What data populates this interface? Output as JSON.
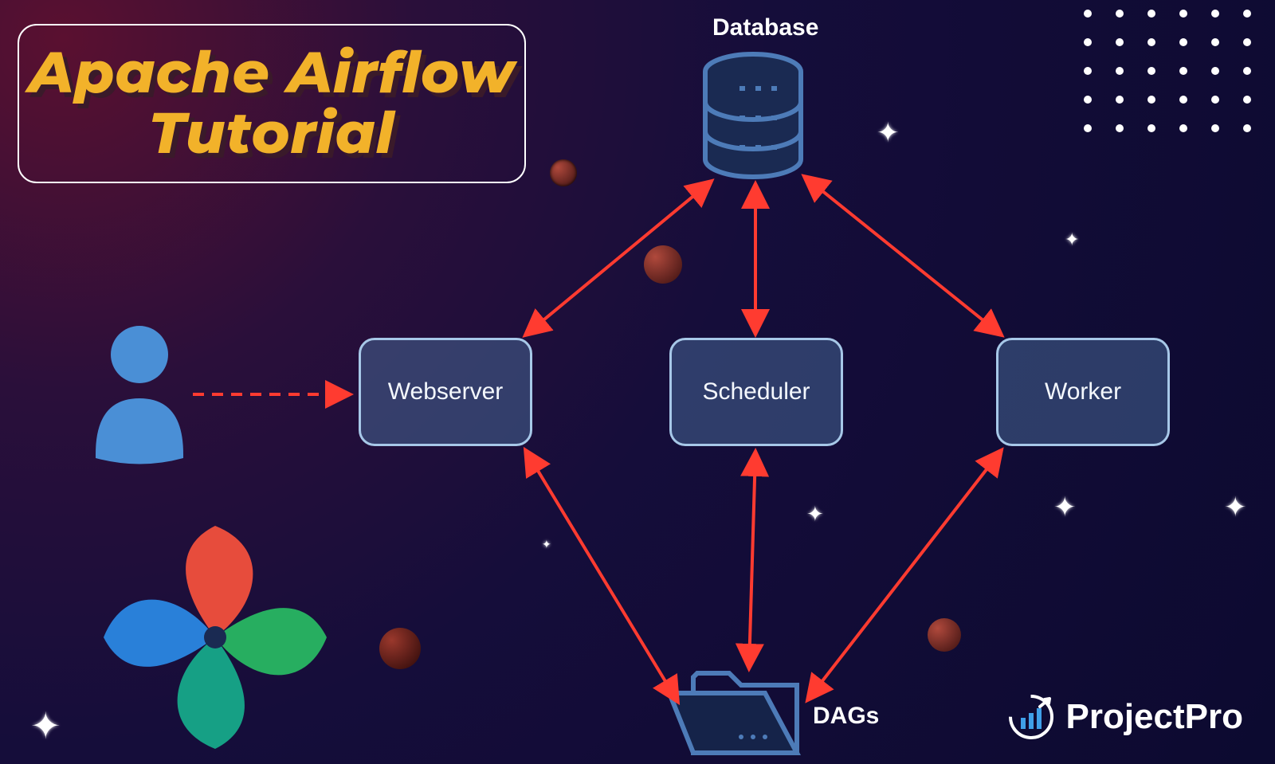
{
  "title": {
    "line1": "Apache Airflow",
    "line2": "Tutorial"
  },
  "nodes": {
    "database": "Database",
    "webserver": "Webserver",
    "scheduler": "Scheduler",
    "worker": "Worker",
    "dags": "DAGs"
  },
  "brand": "ProjectPro",
  "colors": {
    "accent": "#f2b22a",
    "arrow": "#ff3b30",
    "box_border": "#a7c8e8",
    "box_fill": "rgba(74,110,155,0.5)"
  },
  "diagram": {
    "layout": "user -> webserver ; {webserver,scheduler,worker} <-> database(top) ; {webserver,scheduler,worker} <-> dags(bottom)",
    "edges": [
      {
        "from": "user",
        "to": "webserver",
        "style": "dashed",
        "dir": "one"
      },
      {
        "from": "webserver",
        "to": "database",
        "style": "solid",
        "dir": "both"
      },
      {
        "from": "scheduler",
        "to": "database",
        "style": "solid",
        "dir": "both"
      },
      {
        "from": "worker",
        "to": "database",
        "style": "solid",
        "dir": "both"
      },
      {
        "from": "webserver",
        "to": "dags",
        "style": "solid",
        "dir": "both"
      },
      {
        "from": "scheduler",
        "to": "dags",
        "style": "solid",
        "dir": "both"
      },
      {
        "from": "worker",
        "to": "dags",
        "style": "solid",
        "dir": "both"
      }
    ]
  }
}
